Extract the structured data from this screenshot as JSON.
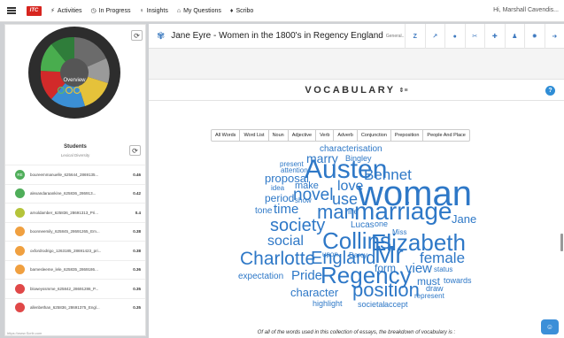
{
  "topnav": {
    "logo_text": "ITC",
    "items": [
      {
        "label": "Activities",
        "icon": "bolt-icon"
      },
      {
        "label": "In Progress",
        "icon": "clock-icon"
      },
      {
        "label": "Insights",
        "icon": "lightbulb-icon"
      },
      {
        "label": "My Questions",
        "icon": "institution-icon"
      },
      {
        "label": "Scribo",
        "icon": "map-pin-icon"
      }
    ],
    "user_text": "Hi, Marshall Cavendis..."
  },
  "sidebar": {
    "overview_label": "Overview",
    "students_heading": "Students",
    "students_sort": "Lexical Diversity",
    "students": [
      {
        "initials": "RE",
        "name": "boureemmanuelle_625644_2869135...",
        "score": "0.46",
        "color": "#4fae5a"
      },
      {
        "initials": "",
        "name": "alexandaraankine_625836_286913...",
        "score": "0.42",
        "color": "#4fae5a"
      },
      {
        "initials": "",
        "name": "arnoldamber_625836_28691313_Pri...",
        "score": "0.4",
        "color": "#b5c43a"
      },
      {
        "initials": "",
        "name": "boonneemily_625845_28691265_Em...",
        "score": "0.38",
        "color": "#f0a040"
      },
      {
        "initials": "",
        "name": "oxfordrodrigo_1263185_28691423_pri...",
        "score": "0.38",
        "color": "#f0a040"
      },
      {
        "initials": "",
        "name": "barnesleeme_lele_625835_2869186...",
        "score": "0.36",
        "color": "#f0a040"
      },
      {
        "initials": "",
        "name": "bloweyssmme_625842_28691286_P...",
        "score": "0.35",
        "color": "#e04848"
      },
      {
        "initials": "",
        "name": "allenbethan_625836_28691375_Engl...",
        "score": "0.35",
        "color": "#e04848"
      }
    ],
    "status_text": "https://www.Scrib.com"
  },
  "document": {
    "title": "Jane Eyre - Women in the 1800's in Regency England",
    "subtitle": "General...",
    "tools": [
      {
        "icon": "z-score-icon",
        "glyph": "Z"
      },
      {
        "icon": "line-chart-icon",
        "glyph": "↗"
      },
      {
        "icon": "comment-icon",
        "glyph": "●"
      },
      {
        "icon": "scissors-icon",
        "glyph": "✂"
      },
      {
        "icon": "plus-square-icon",
        "glyph": "✚"
      },
      {
        "icon": "user-icon",
        "glyph": "♟"
      },
      {
        "icon": "settings-icon",
        "glyph": "✹"
      },
      {
        "icon": "logout-icon",
        "glyph": "➜"
      }
    ]
  },
  "vocabulary": {
    "title": "VOCABULARY",
    "help": "?",
    "filters": [
      "All Words",
      "Word List",
      "Noun",
      "Adjective",
      "Verb",
      "Adverb",
      "Conjunction",
      "Preposition",
      "People And Place"
    ],
    "breakdown_text": "Of all of the words used in this collection of essays, the breakdown of vocabulary is :"
  },
  "cloud": [
    {
      "text": "characterisation",
      "size": 10
    },
    {
      "text": "marry",
      "size": 14
    },
    {
      "text": "Bingley",
      "size": 9
    },
    {
      "text": "present",
      "size": 8
    },
    {
      "text": "attention",
      "size": 8
    },
    {
      "text": "Austen",
      "size": 30
    },
    {
      "text": "Bennet",
      "size": 17
    },
    {
      "text": "proposal",
      "size": 13
    },
    {
      "text": "idea",
      "size": 8
    },
    {
      "text": "make",
      "size": 11
    },
    {
      "text": "woman",
      "size": 40
    },
    {
      "text": "period",
      "size": 12
    },
    {
      "text": "novel",
      "size": 19
    },
    {
      "text": "show",
      "size": 8
    },
    {
      "text": "love",
      "size": 16
    },
    {
      "text": "use",
      "size": 18
    },
    {
      "text": "tone",
      "size": 10
    },
    {
      "text": "time",
      "size": 15
    },
    {
      "text": "man",
      "size": 22
    },
    {
      "text": "life",
      "size": 9
    },
    {
      "text": "marriage",
      "size": 28
    },
    {
      "text": "Jane",
      "size": 13
    },
    {
      "text": "society",
      "size": 20
    },
    {
      "text": "Lucas",
      "size": 10
    },
    {
      "text": "one",
      "size": 9
    },
    {
      "text": "Miss",
      "size": 8
    },
    {
      "text": "Collins",
      "size": 26
    },
    {
      "text": "Elizabeth",
      "size": 26
    },
    {
      "text": "social",
      "size": 16
    },
    {
      "text": "upon",
      "size": 8
    },
    {
      "text": "Darcy",
      "size": 8
    },
    {
      "text": "Charlotte",
      "size": 21
    },
    {
      "text": "England",
      "size": 20
    },
    {
      "text": "Mr",
      "size": 28
    },
    {
      "text": "female",
      "size": 17
    },
    {
      "text": "form",
      "size": 12
    },
    {
      "text": "view",
      "size": 15
    },
    {
      "text": "status",
      "size": 8
    },
    {
      "text": "expectation",
      "size": 10
    },
    {
      "text": "Pride",
      "size": 15
    },
    {
      "text": "Regency",
      "size": 26
    },
    {
      "text": "must",
      "size": 12
    },
    {
      "text": "towards",
      "size": 9
    },
    {
      "text": "character",
      "size": 13
    },
    {
      "text": "draw",
      "size": 9
    },
    {
      "text": "highlight",
      "size": 9
    },
    {
      "text": "position",
      "size": 22
    },
    {
      "text": "represent",
      "size": 8
    },
    {
      "text": "societal",
      "size": 9
    },
    {
      "text": "accept",
      "size": 9
    }
  ]
}
